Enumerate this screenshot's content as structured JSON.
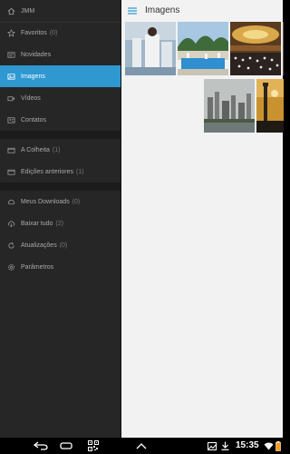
{
  "app": {
    "title": "JMM"
  },
  "header": {
    "title": "Imagens"
  },
  "drawer": {
    "section1": [
      {
        "label": "Favoritos",
        "count": "(0)",
        "icon": "star-icon"
      },
      {
        "label": "Novidades",
        "count": "",
        "icon": "news-icon"
      },
      {
        "label": "Imagens",
        "count": "",
        "icon": "image-icon",
        "active": true
      },
      {
        "label": "Vídeos",
        "count": "",
        "icon": "video-icon"
      },
      {
        "label": "Contatos",
        "count": "",
        "icon": "contacts-icon"
      }
    ],
    "section2": [
      {
        "label": "A Colheita",
        "count": "(1)",
        "icon": "folder-icon"
      },
      {
        "label": "Edições anteriores",
        "count": "(1)",
        "icon": "folder-icon"
      }
    ],
    "section3": [
      {
        "label": "Meus Downloads",
        "count": "(0)",
        "icon": "cloud-icon"
      },
      {
        "label": "Baixar tudo",
        "count": "(2)",
        "icon": "cloud-download-icon"
      },
      {
        "label": "Atualizações",
        "count": "(0)",
        "icon": "refresh-icon"
      },
      {
        "label": "Parâmetros",
        "count": "",
        "icon": "settings-icon"
      }
    ]
  },
  "status": {
    "time": "15:35"
  },
  "colors": {
    "accent": "#2f98d1",
    "drawer_bg": "#262626",
    "content_bg": "#f2f2f2"
  }
}
